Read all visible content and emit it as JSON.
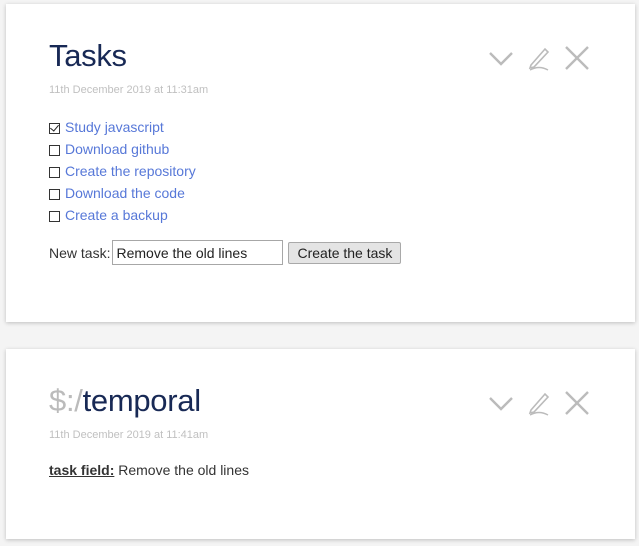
{
  "tiddlers": [
    {
      "title": "Tasks",
      "subtitle": "11th December 2019 at 11:31am",
      "tasks": [
        {
          "label": "Study javascript",
          "checked": true
        },
        {
          "label": "Download github",
          "checked": false
        },
        {
          "label": "Create the repository",
          "checked": false
        },
        {
          "label": "Download the code",
          "checked": false
        },
        {
          "label": "Create a backup",
          "checked": false
        }
      ],
      "new_task": {
        "label": "New task:",
        "value": "Remove the old lines",
        "button": "Create the task"
      },
      "controls": [
        "chevron-down-icon",
        "pencil-icon",
        "close-icon"
      ]
    },
    {
      "title_prefix": "$:/",
      "title_main": "temporal",
      "subtitle": "11th December 2019 at 11:41am",
      "field_name": "task field:",
      "field_value": "Remove the old lines",
      "controls": [
        "chevron-down-icon",
        "pencil-icon",
        "close-icon"
      ]
    }
  ],
  "colors": {
    "title": "#182955",
    "link": "#5778d8",
    "muted": "#c0c0c0",
    "icon": "#bbbbbb"
  }
}
